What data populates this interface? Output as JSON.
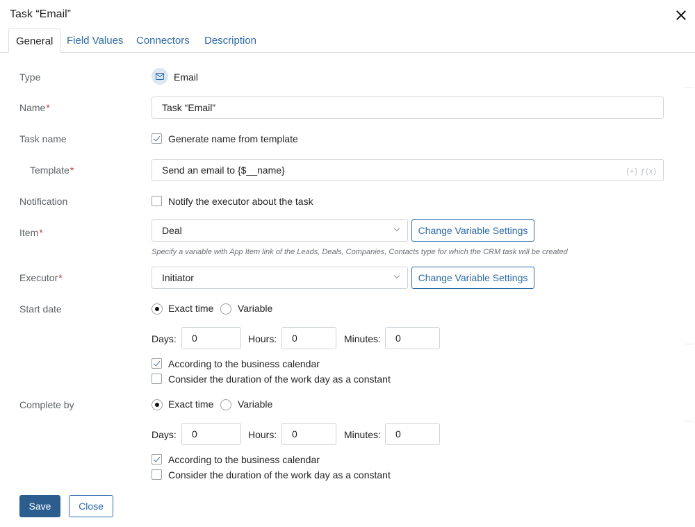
{
  "dialog": {
    "title": "Task “Email”"
  },
  "tabs": [
    {
      "label": "General",
      "active": true
    },
    {
      "label": "Field Values",
      "active": false
    },
    {
      "label": "Connectors",
      "active": false
    },
    {
      "label": "Description",
      "active": false
    }
  ],
  "form": {
    "type": {
      "label": "Type",
      "value": "Email",
      "icon": "envelope-icon"
    },
    "name": {
      "label": "Name",
      "required_mark": "*",
      "value": "Task “Email”"
    },
    "task_name": {
      "label": "Task name",
      "checkbox_label": "Generate name from template",
      "checked": true
    },
    "template": {
      "label": "Template",
      "required_mark": "*",
      "value": "Send an email to {$__name}",
      "tools": "{+} ƒ(x)"
    },
    "notification": {
      "label": "Notification",
      "checkbox_label": "Notify the executor about the task",
      "checked": false
    },
    "item": {
      "label": "Item",
      "required_mark": "*",
      "selected": "Deal",
      "button": "Change Variable Settings",
      "hint": "Specify a variable with App Item link of the Leads, Deals, Companies, Contacts type for which the CRM task will be created"
    },
    "executor": {
      "label": "Executor",
      "required_mark": "*",
      "selected": "Initiator",
      "button": "Change Variable Settings"
    },
    "start_date": {
      "label": "Start date",
      "radio_exact": "Exact time",
      "radio_variable": "Variable",
      "selected": "Exact time",
      "days_label": "Days:",
      "days": "0",
      "hours_label": "Hours:",
      "hours": "0",
      "minutes_label": "Minutes:",
      "minutes": "0",
      "calendar_label": "According to the business calendar",
      "calendar_checked": true,
      "workday_label": "Consider the duration of the work day as a constant",
      "workday_checked": false
    },
    "complete_by": {
      "label": "Complete by",
      "radio_exact": "Exact time",
      "radio_variable": "Variable",
      "selected": "Exact time",
      "days_label": "Days:",
      "days": "0",
      "hours_label": "Hours:",
      "hours": "0",
      "minutes_label": "Minutes:",
      "minutes": "0",
      "calendar_label": "According to the business calendar",
      "calendar_checked": true,
      "workday_label": "Consider the duration of the work day as a constant",
      "workday_checked": false
    }
  },
  "footer": {
    "save": "Save",
    "close": "Close"
  },
  "colors": {
    "accent": "#2a6aad",
    "primary_button": "#2b5e8f",
    "required": "#d0323a"
  }
}
